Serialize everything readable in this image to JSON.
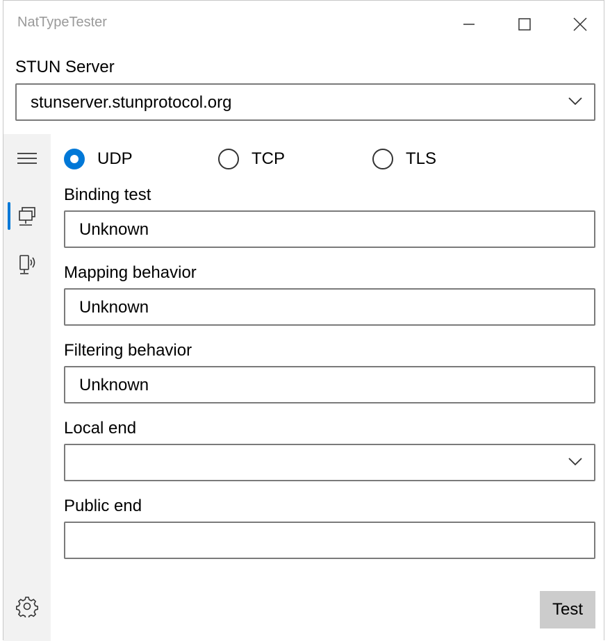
{
  "window": {
    "title": "NatTypeTester"
  },
  "stun": {
    "label": "STUN Server",
    "value": "stunserver.stunprotocol.org"
  },
  "protocols": [
    {
      "label": "UDP",
      "checked": true
    },
    {
      "label": "TCP",
      "checked": false
    },
    {
      "label": "TLS",
      "checked": false
    }
  ],
  "fields": {
    "binding_test": {
      "label": "Binding test",
      "value": "Unknown"
    },
    "mapping_behavior": {
      "label": "Mapping behavior",
      "value": "Unknown"
    },
    "filtering_behavior": {
      "label": "Filtering behavior",
      "value": "Unknown"
    },
    "local_end": {
      "label": "Local end",
      "value": ""
    },
    "public_end": {
      "label": "Public end",
      "value": ""
    }
  },
  "actions": {
    "test_label": "Test"
  },
  "icons": {
    "nav_menu": "hamburger-icon",
    "nav_item_1": "network-monitor-icon",
    "nav_item_2": "device-signal-icon",
    "settings": "gear-icon"
  },
  "colors": {
    "accent": "#0078d7",
    "sidebar_bg": "#f2f2f2",
    "button_bg": "#cccccc"
  }
}
